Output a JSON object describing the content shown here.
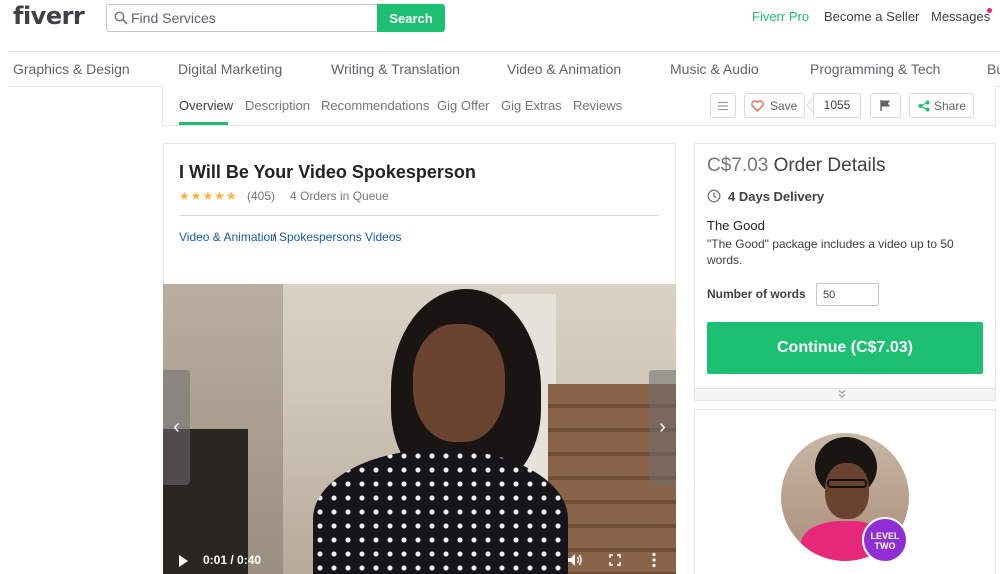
{
  "header": {
    "logo": "fiverr",
    "search": {
      "placeholder": "Find Services",
      "button_label": "Search"
    },
    "nav": {
      "pro": "Fiverr Pro",
      "become_seller": "Become a Seller",
      "messages": "Messages"
    },
    "colors": {
      "brand_green": "#1dbf73",
      "message_dot": "#e0267d"
    }
  },
  "categories": [
    "Graphics & Design",
    "Digital Marketing",
    "Writing & Translation",
    "Video & Animation",
    "Music & Audio",
    "Programming & Tech",
    "Bu"
  ],
  "subnav": {
    "tabs": [
      "Overview",
      "Description",
      "Recommendations",
      "Gig Offer",
      "Gig Extras",
      "Reviews"
    ],
    "active_tab": "Overview",
    "save_label": "Save",
    "save_count": "1055",
    "share_label": "Share"
  },
  "gig": {
    "title": "I Will Be Your Video Spokesperson",
    "stars": "★★★★★",
    "rating": 5,
    "review_count": "(405)",
    "queue": "4 Orders in Queue",
    "breadcrumb": {
      "category": "Video & Animation",
      "separator": " / ",
      "subcategory": "Spokespersons Videos"
    }
  },
  "video": {
    "time": "0:01 / 0:40",
    "prev_arrow": "‹",
    "next_arrow": "›"
  },
  "order": {
    "price": "C$7.03",
    "title": "Order Details",
    "delivery": "4 Days Delivery",
    "package_name": "The Good",
    "package_desc": "\"The Good\" package includes a video up to 50 words.",
    "words_label": "Number of words",
    "words_value": "50",
    "continue_label": "Continue (C$7.03)"
  },
  "seller": {
    "level_badge_line1": "LEVEL",
    "level_badge_line2": "TWO"
  }
}
